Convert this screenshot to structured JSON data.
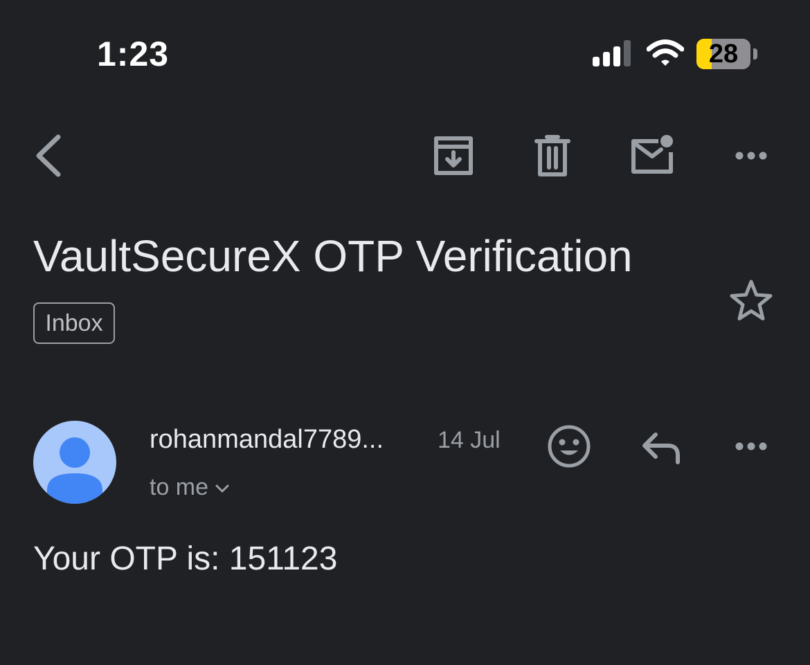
{
  "status_bar": {
    "time": "1:23",
    "battery_level": "28",
    "battery_fraction": 0.28,
    "battery_color": "#ffd60a"
  },
  "toolbar": {
    "icons": [
      "back-arrow-icon",
      "archive-icon",
      "delete-icon",
      "mark-unread-icon",
      "more-icon"
    ]
  },
  "email": {
    "subject": "VaultSecureX OTP Verification",
    "label": "Inbox",
    "sender": {
      "name": "rohanmandal7789...",
      "date": "14 Jul",
      "recipient": "to me",
      "avatar_color": "#a8c7fa"
    },
    "body": "Your OTP is: 151123"
  },
  "colors": {
    "background": "#202124",
    "text_primary": "#e8eaed",
    "text_secondary": "#9aa0a6",
    "avatar_figure": "#4285f4"
  }
}
